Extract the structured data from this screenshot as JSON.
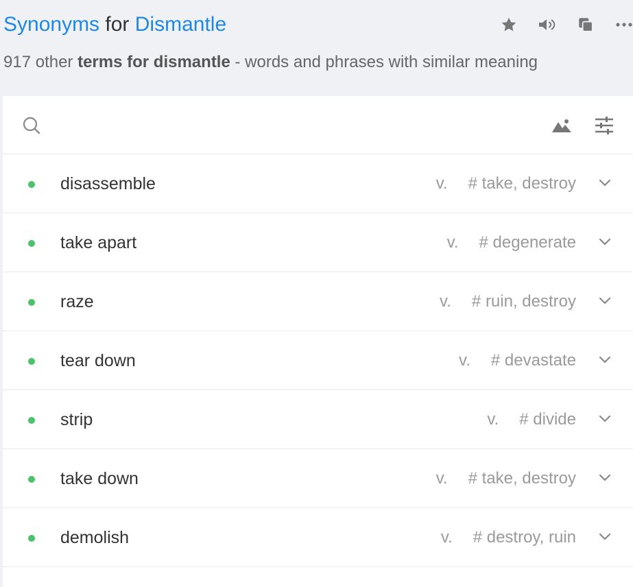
{
  "header": {
    "title": {
      "part1": "Synonyms",
      "part2": "for",
      "part3": "Dismantle"
    },
    "subtitle": {
      "count": "917",
      "text1": "other",
      "bold": "terms for dismantle",
      "text2": "- words and phrases with similar meaning"
    },
    "icons": [
      "star-icon",
      "speaker-icon",
      "copy-icon",
      "more-icon"
    ]
  },
  "toolbar": {
    "icons": [
      "search-icon",
      "image-icon",
      "filter-sliders-icon"
    ]
  },
  "synonyms": [
    {
      "word": "disassemble",
      "pos": "v.",
      "tags": "# take, destroy"
    },
    {
      "word": "take apart",
      "pos": "v.",
      "tags": "# degenerate"
    },
    {
      "word": "raze",
      "pos": "v.",
      "tags": "# ruin, destroy"
    },
    {
      "word": "tear down",
      "pos": "v.",
      "tags": "# devastate"
    },
    {
      "word": "strip",
      "pos": "v.",
      "tags": "# divide"
    },
    {
      "word": "take down",
      "pos": "v.",
      "tags": "# take, destroy"
    },
    {
      "word": "demolish",
      "pos": "v.",
      "tags": "# destroy, ruin"
    }
  ],
  "colors": {
    "accent": "#1e88e5",
    "dot": "#4cc26a",
    "muted": "#9a9a9a",
    "background": "#eff1f5"
  }
}
